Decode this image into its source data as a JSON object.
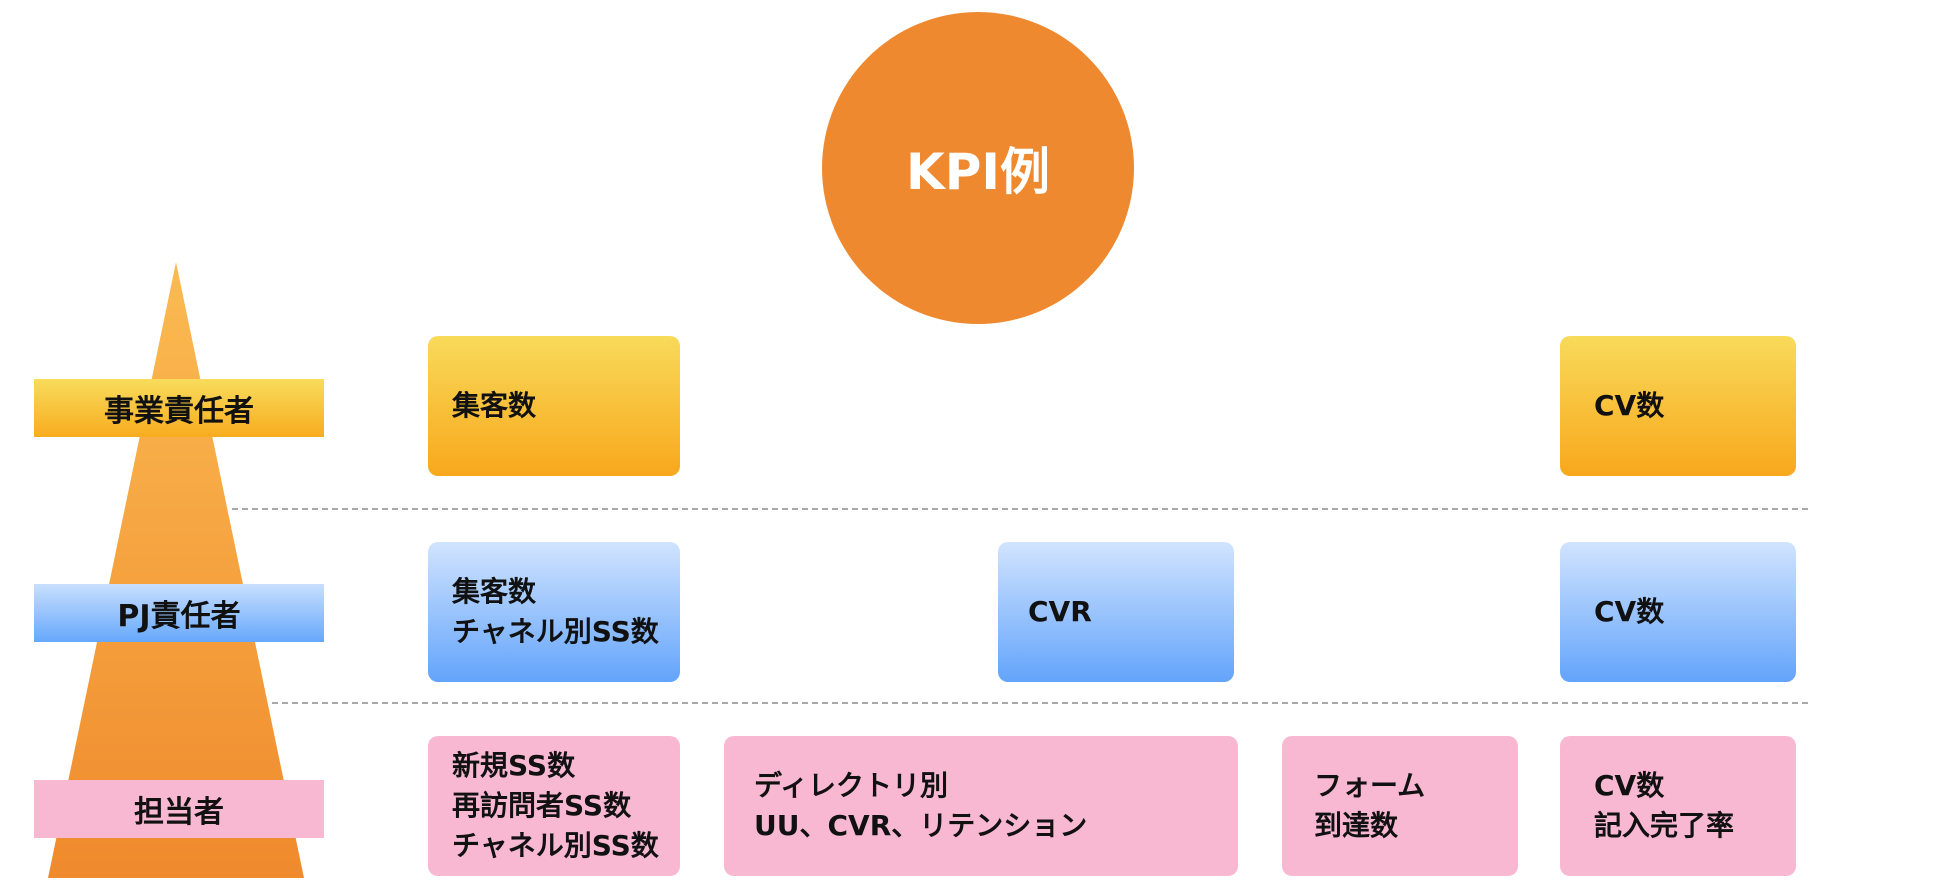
{
  "title": "KPI例",
  "roles": {
    "business_owner": "事業責任者",
    "project_owner": "PJ責任者",
    "staff": "担当者"
  },
  "rows": {
    "business_owner": {
      "acquisition": [
        "集客数"
      ],
      "cv": [
        "CV数"
      ]
    },
    "project_owner": {
      "acquisition": [
        "集客数",
        "チャネル別SS数"
      ],
      "cvr": [
        "CVR"
      ],
      "cv": [
        "CV数"
      ]
    },
    "staff": {
      "acquisition": [
        "新規SS数",
        "再訪問者SS数",
        "チャネル別SS数"
      ],
      "directory": [
        "ディレクトリ別",
        "UU、CVR、リテンション"
      ],
      "form": [
        "フォーム",
        "到達数"
      ],
      "cv": [
        "CV数",
        "記入完了率"
      ]
    }
  },
  "colors": {
    "circle": "#ef892f",
    "pyramid": "#f29634",
    "yellow": "#f8c23a",
    "blue": "#8cbcfc",
    "pink": "#f8b8d2"
  }
}
